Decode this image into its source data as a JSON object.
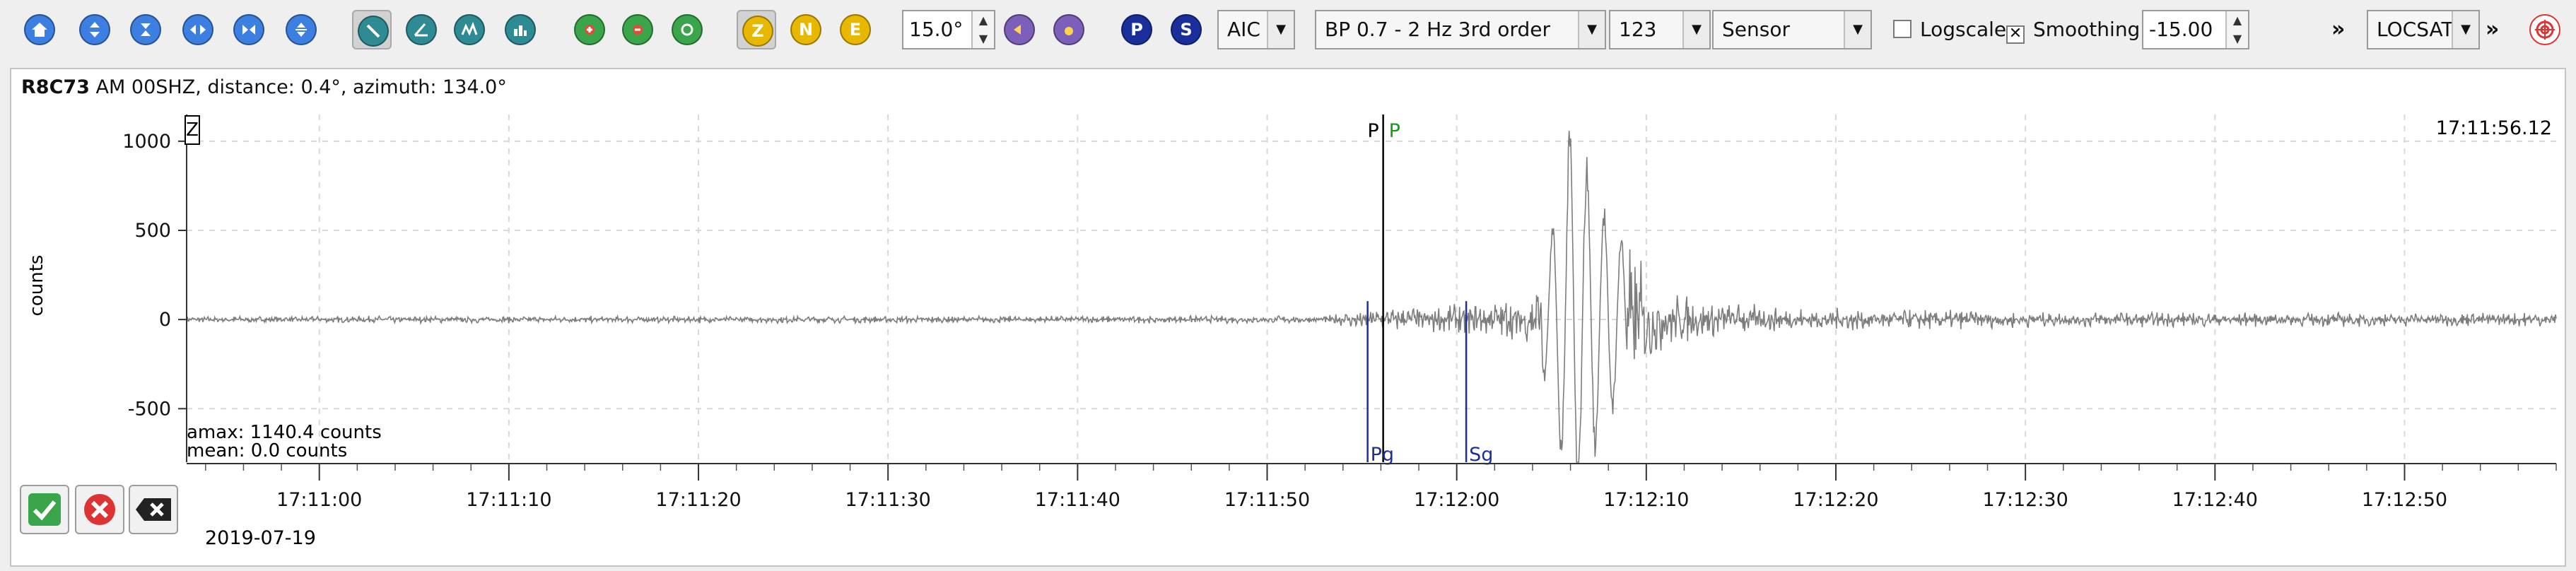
{
  "toolbar": {
    "nav_buttons": [
      {
        "icon": "home-icon"
      },
      {
        "icon": "zoom-in-vertical-icon"
      },
      {
        "icon": "zoom-out-vertical-icon"
      },
      {
        "icon": "zoom-in-horizontal-icon"
      },
      {
        "icon": "zoom-out-horizontal-icon"
      },
      {
        "icon": "align-icon"
      }
    ],
    "tool_buttons": [
      {
        "icon": "pick-tool-icon",
        "pressed": true
      },
      {
        "icon": "measure-icon",
        "pressed": false
      },
      {
        "icon": "amplitude-icon",
        "pressed": false
      },
      {
        "icon": "spectrogram-icon",
        "pressed": false
      }
    ],
    "green_buttons": [
      {
        "icon": "add-icon"
      },
      {
        "icon": "remove-icon"
      },
      {
        "icon": "refresh-icon"
      }
    ],
    "components": [
      {
        "label": "Z",
        "pressed": true
      },
      {
        "label": "N",
        "pressed": false
      },
      {
        "label": "E",
        "pressed": false
      }
    ],
    "rotation_value": "15.0°",
    "phase_buttons": [
      {
        "label": "P",
        "color": "#1b2f9a"
      },
      {
        "label": "S",
        "color": "#1b2f9a"
      }
    ],
    "picker_method": "AIC",
    "filter": "BP 0.7 - 2 Hz  3rd order",
    "rotation_mode": "123",
    "unit_mode": "Sensor",
    "logscale_label": "Logscale",
    "logscale_checked": false,
    "smoothing_label": "Smoothing",
    "smoothing_checked": true,
    "offset_value": "-15.00",
    "more_glyph": "»",
    "locator": "LOCSAT",
    "locator_more_glyph": "»",
    "colors": {
      "accent_yellow": "#e8b800",
      "green": "#3aa54a",
      "purple": "#7b5fb8",
      "blue": "#2f6fd1",
      "red": "#d33"
    }
  },
  "station": {
    "code": "R8C73",
    "info": "  AM  00SHZ, distance: 0.4°, azimuth: 134.0°"
  },
  "trace": {
    "component_label": "Z",
    "time_label": "17:11:56.12",
    "y_axis_label": "counts",
    "amax_text": "amax: 1140.4 counts",
    "mean_text": "mean: 0.0 counts",
    "date_text": "2019-07-19"
  },
  "chart_data": {
    "type": "line",
    "title": "",
    "xlabel": "",
    "ylabel": "counts",
    "x_range": [
      "17:10:53",
      "17:12:58"
    ],
    "ylim": [
      -800,
      1150
    ],
    "y_ticks": [
      1000,
      500,
      0,
      -500
    ],
    "y_tick_labels": [
      "1000",
      "500",
      "0",
      "-500"
    ],
    "x_tick_labels": [
      "17:11:00",
      "17:11:10",
      "17:11:20",
      "17:11:30",
      "17:11:40",
      "17:11:50",
      "17:12:00",
      "17:12:10",
      "17:12:20",
      "17:12:30",
      "17:12:40",
      "17:12:50"
    ],
    "grid": true,
    "series": [
      {
        "color": "#7d7d7d",
        "envelope_seconds": [
          0,
          60,
          62,
          67,
          71,
          72,
          73,
          74,
          75,
          76,
          78,
          80,
          85,
          100,
          125
        ],
        "envelope_counts": [
          20,
          22,
          60,
          90,
          150,
          500,
          1140,
          900,
          600,
          450,
          180,
          110,
          70,
          45,
          40
        ]
      }
    ],
    "markers": [
      {
        "label": "P",
        "time": "17:11:56.12",
        "color": "#000000",
        "position": "top"
      },
      {
        "label": "P",
        "time": "17:11:56.12",
        "color": "#1a9a1a",
        "position": "top"
      },
      {
        "label": "Pg",
        "time": "17:11:55.3",
        "color": "#1b2f9a",
        "position": "bottom"
      },
      {
        "label": "Sg",
        "time": "17:12:00.5",
        "color": "#1b2f9a",
        "position": "bottom"
      }
    ]
  },
  "actions": [
    {
      "name": "accept-button",
      "icon": "check-icon"
    },
    {
      "name": "reject-button",
      "icon": "cancel-icon"
    },
    {
      "name": "clear-button",
      "icon": "clear-icon"
    }
  ]
}
